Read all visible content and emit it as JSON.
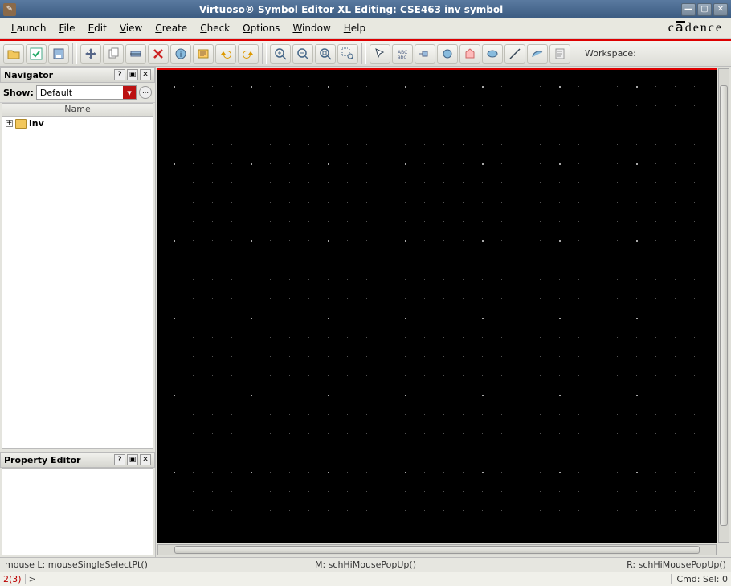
{
  "window": {
    "title": "Virtuoso® Symbol Editor XL Editing: CSE463 inv symbol"
  },
  "menu": {
    "items": [
      "Launch",
      "File",
      "Edit",
      "View",
      "Create",
      "Check",
      "Options",
      "Window",
      "Help"
    ],
    "brand": "cādence"
  },
  "toolbar": {
    "groups": [
      [
        {
          "name": "open-icon",
          "svg": "<path fill='#f2c75c' stroke='#b08a2a' d='M1 4h5l2 2h7v8H1z'/>"
        },
        {
          "name": "check-save-icon",
          "svg": "<rect x='1' y='1' width='14' height='14' fill='#fff' stroke='#4a8'/><path d='M4 8l3 3 5-6' stroke='#2a6' fill='none' stroke-width='2'/>"
        },
        {
          "name": "save-icon",
          "svg": "<rect x='2' y='2' width='12' height='12' fill='#9bd' stroke='#568'/><rect x='5' y='9' width='6' height='4' fill='#fff'/>"
        }
      ],
      [
        {
          "name": "move-icon",
          "svg": "<path d='M8 1l2 3h-1v3h3v-1l3 2-3 2v-1h-3v3h1l-2 3-2-3h1v-3h-3v1l-3-2 3-2v1h3v-3h-1z' fill='#568'/>"
        },
        {
          "name": "copy-icon",
          "svg": "<rect x='3' y='3' width='8' height='10' fill='#fff' stroke='#888'/><rect x='6' y='1' width='8' height='10' fill='#fff' stroke='#888'/>"
        },
        {
          "name": "stretch-icon",
          "svg": "<rect x='2' y='5' width='12' height='6' fill='#9bd' stroke='#568'/><path d='M1 8h14' stroke='#345'/>"
        },
        {
          "name": "delete-icon",
          "svg": "<path d='M3 3l10 10M13 3L3 13' stroke='#c22' stroke-width='2.5'/>"
        },
        {
          "name": "info-icon",
          "svg": "<circle cx='8' cy='8' r='6' fill='#8bd' stroke='#468'/><text x='8' y='12' text-anchor='middle' font-size='10' fill='#246'>i</text>"
        },
        {
          "name": "properties-icon",
          "svg": "<rect x='2' y='3' width='12' height='10' fill='#fc6' stroke='#a82'/><path d='M4 6h8M4 8h8M4 10h5' stroke='#864'/>"
        },
        {
          "name": "undo-icon",
          "svg": "<path d='M10 4a5 5 0 1 1-5 5H2l3-4 3 4H6a4 4 0 1 0 4-4z' fill='#d90'/>"
        },
        {
          "name": "redo-icon",
          "svg": "<path d='M6 4a5 5 0 1 0 5 5h3l-3-4-3 4h2a4 4 0 1 1-4-4z' fill='#d90'/>"
        }
      ],
      [
        {
          "name": "zoom-in-icon",
          "svg": "<circle cx='7' cy='7' r='5' fill='none' stroke='#468' stroke-width='1.5'/><path d='M11 11l4 4' stroke='#468' stroke-width='1.5'/><path d='M5 7h4M7 5v4' stroke='#468'/>"
        },
        {
          "name": "zoom-out-icon",
          "svg": "<circle cx='7' cy='7' r='5' fill='none' stroke='#468' stroke-width='1.5'/><path d='M11 11l4 4' stroke='#468' stroke-width='1.5'/><path d='M5 7h4' stroke='#468'/>"
        },
        {
          "name": "zoom-fit-icon",
          "svg": "<circle cx='7' cy='7' r='5' fill='none' stroke='#468' stroke-width='1.5'/><path d='M11 11l4 4' stroke='#468' stroke-width='1.5'/><rect x='5' y='5' width='4' height='4' fill='none' stroke='#468'/>"
        },
        {
          "name": "zoom-select-icon",
          "svg": "<rect x='1' y='1' width='9' height='9' fill='none' stroke='#468' stroke-dasharray='1 1'/><circle cx='11' cy='11' r='3' fill='none' stroke='#468'/><path d='M13 13l2 2' stroke='#468'/>"
        }
      ],
      [
        {
          "name": "select-icon",
          "svg": "<path d='M3 2l3 10 2-4 4-2z' fill='#fff' stroke='#345'/>"
        },
        {
          "name": "label-icon",
          "svg": "<text x='2' y='8' font-size='6' fill='#568'>ABC</text><text x='2' y='14' font-size='6' fill='#568'>abc</text>"
        },
        {
          "name": "pin-icon",
          "svg": "<rect x='5' y='5' width='6' height='6' fill='#9bd' stroke='#568'/><path d='M1 8h4' stroke='#568'/>"
        },
        {
          "name": "circle-icon",
          "svg": "<circle cx='8' cy='8' r='5' fill='#8bd' stroke='#468'/>"
        },
        {
          "name": "polygon-icon",
          "svg": "<path d='M3 13L3 6l5-4 5 4v7z' fill='#fbb' stroke='#c66'/>"
        },
        {
          "name": "ellipse-icon",
          "svg": "<ellipse cx='8' cy='8' rx='6' ry='4' fill='#8bd' stroke='#468'/>"
        },
        {
          "name": "line-icon",
          "svg": "<path d='M2 14L14 2' stroke='#345' stroke-width='1.5'/>"
        },
        {
          "name": "arc-icon",
          "svg": "<path d='M2 12a8 8 0 0 1 12-6' fill='#8bd' stroke='#468'/>"
        },
        {
          "name": "note-icon",
          "svg": "<rect x='3' y='2' width='10' height='12' fill='#eee' stroke='#999'/><path d='M5 5h6M5 8h6M5 11h4' stroke='#999'/>"
        }
      ]
    ],
    "workspace_label": "Workspace:"
  },
  "navigator": {
    "title": "Navigator",
    "show_label": "Show:",
    "show_value": "Default",
    "column": "Name",
    "tree": {
      "root": "inv"
    }
  },
  "property_editor": {
    "title": "Property Editor"
  },
  "status": {
    "left": "mouse L: mouseSingleSelectPt()",
    "mid": "M: schHiMousePopUp()",
    "right": "R: schHiMousePopUp()"
  },
  "cmd": {
    "line": "2(3)",
    "prompt": ">",
    "sel": "Cmd: Sel: 0"
  }
}
